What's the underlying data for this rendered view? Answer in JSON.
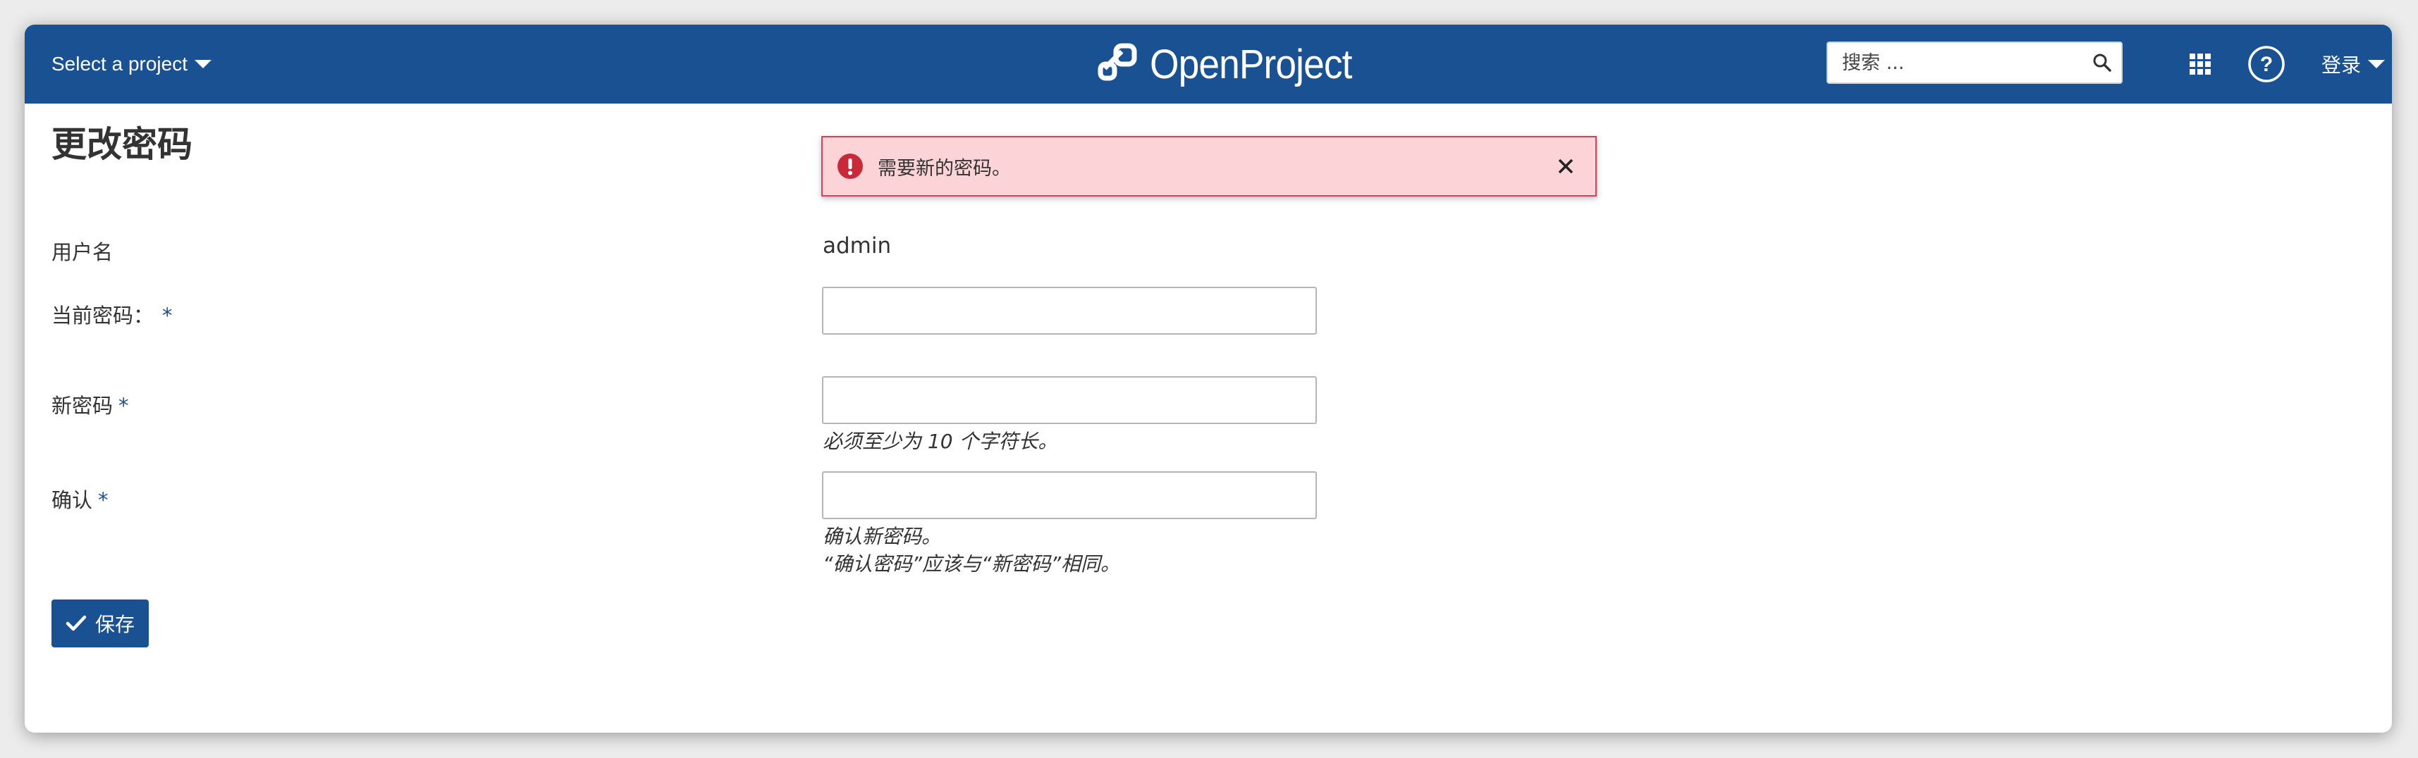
{
  "header": {
    "project_select_label": "Select a project",
    "logo_text": "OpenProject",
    "search_placeholder": "搜索 ...",
    "login_label": "登录",
    "colors": {
      "bar": "#1a5192"
    }
  },
  "page": {
    "title": "更改密码"
  },
  "flash": {
    "message": "需要新的密码。",
    "icon": "error-circle-icon"
  },
  "form": {
    "username_label": "用户名",
    "username_value": "admin",
    "current_password_label": "当前密码：",
    "new_password_label": "新密码",
    "new_password_hint": "必须至少为 10 个字符长。",
    "confirm_label": "确认",
    "confirm_hint": "确认新密码。",
    "confirm_hint2": "“确认密码”应该与“新密码”相同。",
    "required_marker": "*",
    "save_label": "保存"
  }
}
